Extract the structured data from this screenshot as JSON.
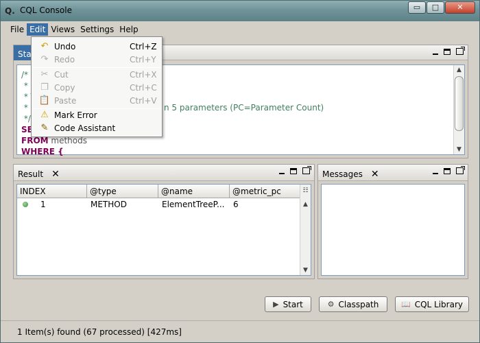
{
  "window": {
    "title": "CQL Console",
    "min_glyph": "▭",
    "max_glyph": "□",
    "close_glyph": "✕"
  },
  "menubar": {
    "items": [
      "File",
      "Edit",
      "Views",
      "Settings",
      "Help"
    ],
    "active": "Edit"
  },
  "edit_menu": {
    "items": [
      {
        "label": "Undo",
        "accel": "Ctrl+Z",
        "icon": "undo-icon",
        "enabled": true
      },
      {
        "label": "Redo",
        "accel": "Ctrl+Y",
        "icon": "redo-icon",
        "enabled": false
      },
      {
        "label": "Cut",
        "accel": "Ctrl+X",
        "icon": "scissors-icon",
        "enabled": false
      },
      {
        "label": "Copy",
        "accel": "Ctrl+C",
        "icon": "copy-icon",
        "enabled": false
      },
      {
        "label": "Paste",
        "accel": "Ctrl+V",
        "icon": "clipboard-icon",
        "enabled": false
      },
      {
        "label": "Mark Error",
        "accel": "",
        "icon": "warning-icon",
        "enabled": true
      },
      {
        "label": "Code Assistant",
        "accel": "",
        "icon": "wand-icon",
        "enabled": true
      }
    ]
  },
  "statement_panel": {
    "tab_label": "Stat"
  },
  "editor": {
    "lines": [
      {
        "text": "/*",
        "style": "cm"
      },
      {
        "text": " * S",
        "style": "cm"
      },
      {
        "text": " * T",
        "style": "cm"
      },
      {
        "text": " *",
        "style": "cm"
      },
      {
        "text": " */",
        "style": "cm"
      },
      {
        "text": "SE",
        "style": "kw"
      },
      {
        "text": "FROM",
        "style": "kw",
        "rest": " methods"
      },
      {
        "text": "WHERE {",
        "style": "kw"
      }
    ],
    "visible_comment_tail": "n 5 parameters (PC=Parameter Count)"
  },
  "result_panel": {
    "tab_label": "Result",
    "columns": [
      "INDEX",
      "@type",
      "@name",
      "@metric_pc"
    ],
    "rows": [
      {
        "index": "1",
        "type": "METHOD",
        "name": "ElementTreeP...",
        "metric_pc": "6"
      }
    ]
  },
  "messages_panel": {
    "tab_label": "Messages"
  },
  "buttons": {
    "start": "Start",
    "classpath": "Classpath",
    "cql_library": "CQL Library"
  },
  "status": {
    "text": "1 Item(s) found (67 processed) [427ms]"
  },
  "colors": {
    "accent": "#3a6ea5",
    "comment": "#3f7f5f",
    "keyword": "#7f0055",
    "status_dot": "#3c8a3c"
  }
}
